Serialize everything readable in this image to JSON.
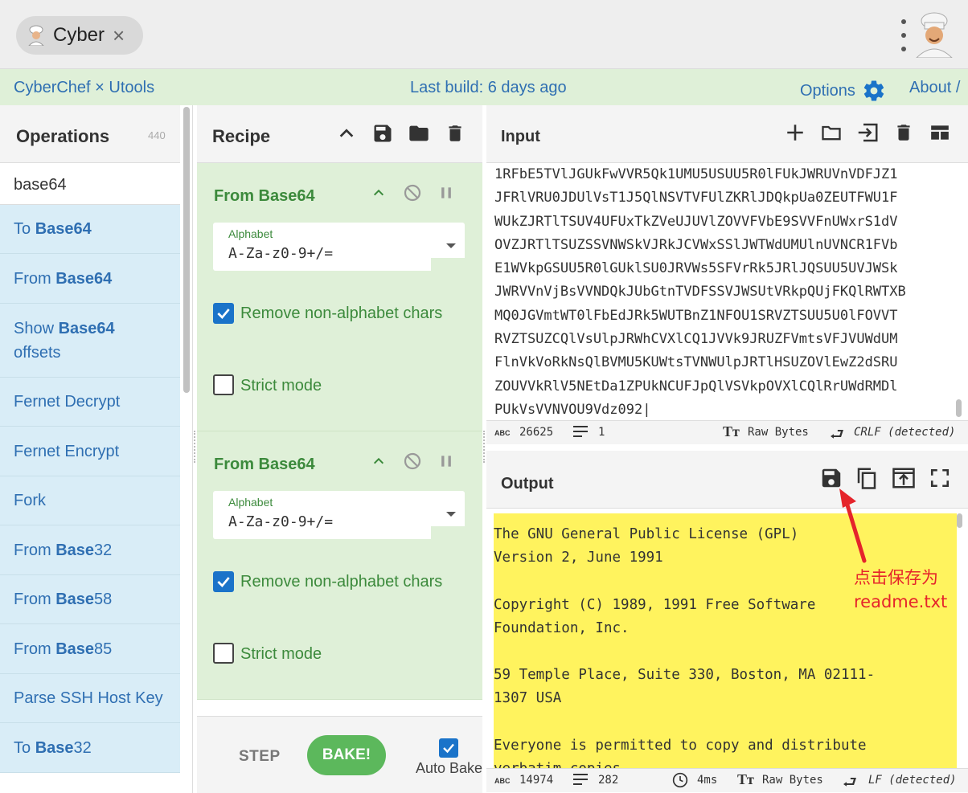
{
  "window": {
    "tab_title": "Cyber",
    "tab_close": "×"
  },
  "banner": {
    "brand": "CyberChef × Utools",
    "build": "Last build: 6 days ago",
    "options": "Options",
    "about": "About /"
  },
  "operations": {
    "title": "Operations",
    "count": "440",
    "search_value": "base64",
    "items": [
      {
        "pre": "To ",
        "bold": "Base64",
        "post": ""
      },
      {
        "pre": "From ",
        "bold": "Base64",
        "post": ""
      },
      {
        "pre": "Show ",
        "bold": "Base64",
        "post": " offsets"
      },
      {
        "pre": "Fernet Decrypt",
        "bold": "",
        "post": ""
      },
      {
        "pre": "Fernet Encrypt",
        "bold": "",
        "post": ""
      },
      {
        "pre": "Fork",
        "bold": "",
        "post": ""
      },
      {
        "pre": "From ",
        "bold": "Base",
        "post": "32"
      },
      {
        "pre": "From ",
        "bold": "Base",
        "post": "58"
      },
      {
        "pre": "From ",
        "bold": "Base",
        "post": "85"
      },
      {
        "pre": "Parse SSH Host Key",
        "bold": "",
        "post": ""
      },
      {
        "pre": "To ",
        "bold": "Base",
        "post": "32"
      }
    ]
  },
  "recipe": {
    "title": "Recipe",
    "blocks": [
      {
        "name": "From Base64",
        "alphabet_label": "Alphabet",
        "alphabet_value": "A-Za-z0-9+/=",
        "remove_label": "Remove non-alphabet chars",
        "remove_checked": true,
        "strict_label": "Strict mode",
        "strict_checked": false
      },
      {
        "name": "From Base64",
        "alphabet_label": "Alphabet",
        "alphabet_value": "A-Za-z0-9+/=",
        "remove_label": "Remove non-alphabet chars",
        "remove_checked": true,
        "strict_label": "Strict mode",
        "strict_checked": false
      }
    ],
    "step_label": "STEP",
    "bake_label": "BAKE!",
    "auto_bake_label": "Auto Bake",
    "auto_bake_checked": true
  },
  "input": {
    "title": "Input",
    "lines": [
      "1RFbE5TVlJGUkFwVVR5Qk1UMU5USUU5R0lFUkJWRUVnVDFJZ1",
      "JFRlVRU0JDUlVsT1J5QlNSVTVFUlZKRlJDQkpUa0ZEUTFWU1F",
      "WUkZJRTlTSUV4UFUxTkZVeUJUVlZOVVFVbE9SVVFnUWxrS1dV",
      "OVZJRTlTSUZSSVNWSkVJRkJCVWxSSlJWTWdUMUlnUVNCR1FVb",
      "E1WVkpGSUU5R0lGUklSU0JRVWs5SFVrRk5JRlJQSUU5UVJWSk",
      "JWRVVnVjBsVVNDQkJUbGtnTVDFSSVJWSUtVRkpQUjFKQlRWTXB",
      "MQ0JGVmtWT0lFbEdJRk5WUTBnZ1NFOU1SRVZTSUU5U0lFOVVT",
      "RVZTSUZCQlVsUlpJRWhCVXlCQ1JVVk9JRUZFVmtsVFJVUWdUM",
      "FlnVkVoRkNsQlBVMU5KUWtsTVNWUlpJRTlHSUZOVlEwZ2dSRU",
      "ZOUVVkRlV5NEtDa1ZPUkNCUFJpQlVSVkpOVXlCQlRrUWdRMDl",
      "PUkVsVVNVOU9Vdz092"
    ],
    "char_count": "26625",
    "line_count": "1",
    "encoding": "Raw Bytes",
    "eol": "CRLF (detected)"
  },
  "output": {
    "title": "Output",
    "lines": [
      "The GNU General Public License (GPL)",
      "Version 2, June 1991",
      "",
      "Copyright (C) 1989, 1991 Free Software",
      "Foundation, Inc.",
      "",
      "59 Temple Place, Suite 330, Boston, MA 02111-",
      "1307 USA",
      "",
      "Everyone is permitted to copy and distribute",
      "verbatim copies"
    ],
    "char_count": "14974",
    "line_count": "282",
    "time": "4ms",
    "encoding": "Raw Bytes",
    "eol": "LF (detected)",
    "highlight_color": "#fff35e"
  },
  "annotation": {
    "line1": "点击保存为",
    "line2": "readme.txt",
    "color": "#e5242b"
  },
  "colors": {
    "banner_bg": "#dff0d8",
    "ops_item_bg": "#d9edf7",
    "link": "#2f6fb2",
    "recipe_green": "#3c8a3c",
    "bake_button": "#5cb85c",
    "checkbox": "#1a73c9"
  },
  "icons": {
    "options": "gear-icon",
    "recipe_toolbar": [
      "chevron-up-icon",
      "save-icon",
      "folder-icon",
      "trash-icon"
    ],
    "input_toolbar": [
      "plus-icon",
      "folder-icon",
      "import-icon",
      "trash-icon",
      "layout-icon"
    ],
    "output_toolbar": [
      "save-icon",
      "copy-icon",
      "replace-input-icon",
      "fullscreen-icon"
    ]
  }
}
